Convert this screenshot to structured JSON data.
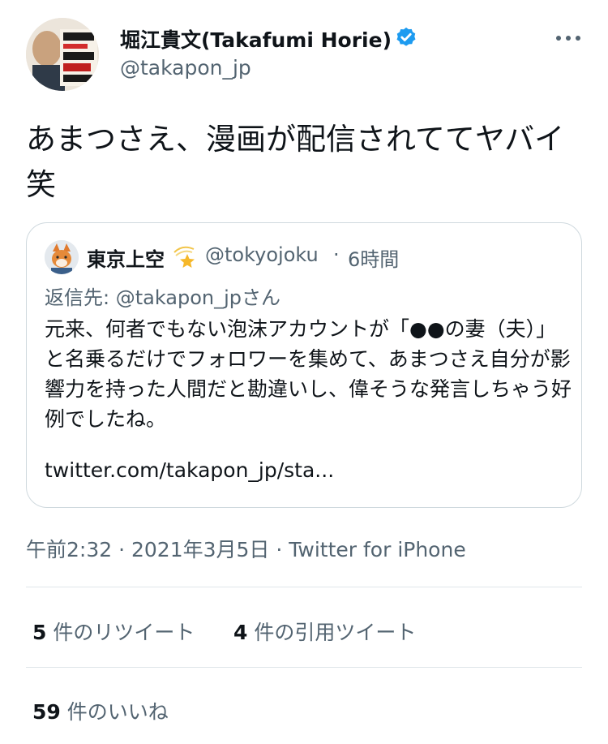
{
  "author": {
    "display_name": "堀江貴文(Takafumi Horie)",
    "handle": "@takapon_jp",
    "avatar_text": "非常識にぜんぶ無視し生きろ",
    "verified_icon": "verified-badge-icon",
    "more_icon": "more-options-icon"
  },
  "tweet": {
    "text": "あまつさえ、漫画が配信されててヤバイ笑"
  },
  "quoted_tweet": {
    "display_name": "東京上空",
    "name_emoji": "dizzy-star-icon",
    "handle": "@tokyojoku",
    "separator": "·",
    "time_ago": "6時間",
    "reply_to": "返信先: @takapon_jpさん",
    "text": "元来、何者でもない泡沫アカウントが「●●の妻（夫）」と名乗るだけでフォロワーを集めて、あまつさえ自分が影響力を持った人間だと勘違いし、偉そうな発言しちゃう好例でしたね。",
    "link": "twitter.com/takapon_jp/sta..."
  },
  "meta": {
    "timestamp": "午前2:32 · 2021年3月5日 · Twitter for iPhone"
  },
  "stats": {
    "retweets_count": "5",
    "retweets_label": "件のリツイート",
    "quotes_count": "4",
    "quotes_label": "件の引用ツイート",
    "likes_count": "59",
    "likes_label": "件のいいね"
  },
  "colors": {
    "verified": "#1d9bf0",
    "secondary_text": "#536471",
    "border": "#cfd9de"
  }
}
